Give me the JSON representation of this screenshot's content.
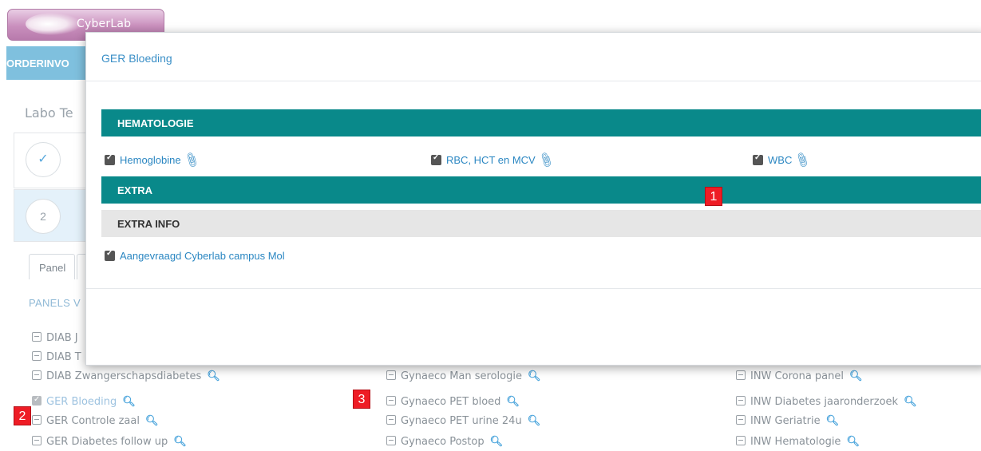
{
  "app": {
    "logo_text": "CyberLab"
  },
  "nav": {
    "item": "ORDERINVO"
  },
  "labo": {
    "title": "Labo Te"
  },
  "steps": [
    {
      "label": "✓"
    },
    {
      "label": "2"
    }
  ],
  "tabs": {
    "panel": "Panel"
  },
  "panels_heading": "PANELS V",
  "panel_columns": [
    [
      {
        "label": "DIAB J",
        "checked": false
      },
      {
        "label": "DIAB T",
        "checked": false
      },
      {
        "label": "DIAB Zwangerschapsdiabetes",
        "checked": false
      },
      {
        "label": "GER Bloeding",
        "checked": true
      },
      {
        "label": "GER Controle zaal",
        "checked": false
      },
      {
        "label": "GER Diabetes follow up",
        "checked": false
      }
    ],
    [
      {
        "label": "Gynaeco Man serologie",
        "checked": false
      },
      {
        "label": "Gynaeco PET bloed",
        "checked": false
      },
      {
        "label": "Gynaeco PET urine 24u",
        "checked": false
      },
      {
        "label": "Gynaeco Postop",
        "checked": false
      }
    ],
    [
      {
        "label": "INW Corona panel",
        "checked": false
      },
      {
        "label": "INW Diabetes jaaronderzoek",
        "checked": false
      },
      {
        "label": "INW Geriatrie",
        "checked": false
      },
      {
        "label": "INW Hematologie",
        "checked": false
      }
    ]
  ],
  "markers": [
    "1",
    "2",
    "3"
  ],
  "modal": {
    "title": "GER Bloeding",
    "sections": {
      "hematologie": "HEMATOLOGIE",
      "extra": "EXTRA",
      "extra_info": "EXTRA INFO"
    },
    "hematologie_tests": [
      "Hemoglobine",
      "RBC, HCT en MCV",
      "WBC"
    ],
    "extra_info_tests": [
      "Aangevraagd Cyberlab campus Mol"
    ]
  },
  "colors": {
    "teal": "#09898a",
    "link": "#2b87c2",
    "nav": "#7fc0de",
    "marker": "#ee1c25"
  }
}
